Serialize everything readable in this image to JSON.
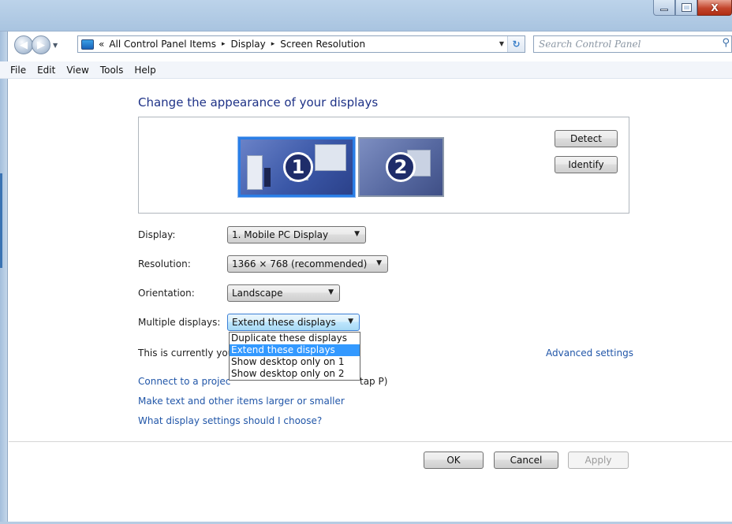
{
  "window": {
    "caption_buttons": {
      "minimize": "minimize-icon",
      "maximize": "maximize-icon",
      "close": "X"
    }
  },
  "address_bar": {
    "overflow": "«",
    "crumbs": [
      "All Control Panel Items",
      "Display",
      "Screen Resolution"
    ],
    "separator": "▸"
  },
  "search": {
    "placeholder": "Search Control Panel"
  },
  "menu": [
    "File",
    "Edit",
    "View",
    "Tools",
    "Help"
  ],
  "page": {
    "title": "Change the appearance of your displays",
    "monitors": [
      {
        "number": "1",
        "selected": true
      },
      {
        "number": "2",
        "selected": false
      }
    ],
    "detect_label": "Detect",
    "identify_label": "Identify",
    "fields": {
      "display": {
        "label": "Display:",
        "value": "1. Mobile PC Display"
      },
      "resolution": {
        "label": "Resolution:",
        "value": "1366 × 768 (recommended)"
      },
      "orientation": {
        "label": "Orientation:",
        "value": "Landscape"
      },
      "multiple": {
        "label": "Multiple displays:",
        "value": "Extend these displays",
        "options": [
          "Duplicate these displays",
          "Extend these displays",
          "Show desktop only on 1",
          "Show desktop only on 2"
        ]
      }
    },
    "status_visible": "This is currently you",
    "advanced_link": "Advanced settings",
    "links": {
      "projector_visible": "Connect to a projec",
      "projector_tail": "tap P)",
      "text_size": "Make text and other items larger or smaller",
      "help": "What display settings should I choose?"
    }
  },
  "footer": {
    "ok": "OK",
    "cancel": "Cancel",
    "apply": "Apply"
  },
  "colors": {
    "link": "#2156a8",
    "title": "#1e3287",
    "selection": "#3399ff"
  }
}
